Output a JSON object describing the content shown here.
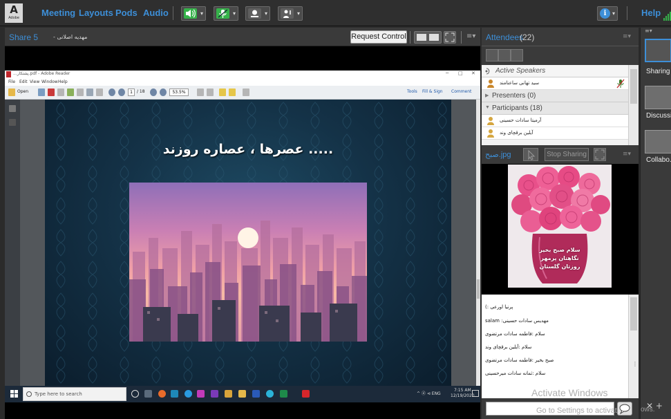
{
  "menubar": {
    "logo_text": "A",
    "logo_sub": "Adobe",
    "items": [
      "Meeting",
      "Layouts",
      "Pods",
      "Audio"
    ],
    "help": "Help"
  },
  "share_pod": {
    "title": "Share 5",
    "subtitle": "- مهدیه اصلانی",
    "request_control": "Request Control",
    "menu_icon": "≡▾"
  },
  "reader": {
    "window_title": "...پشتکار.pdf - Adobe Reader",
    "menu": [
      "File",
      "Edit",
      "View",
      "Window",
      "Help"
    ],
    "open_label": "Open",
    "page_current": "1",
    "page_total": "/ 18",
    "zoom": "53.5%",
    "right_tools": [
      "Tools",
      "Fill & Sign",
      "Comment"
    ],
    "slide_title": "..... عصرها ، عصاره روزند"
  },
  "taskbar": {
    "search_placeholder": "Type here to search",
    "tray": "^ ⓓ ⊲ ENG",
    "time": "7:15 AM",
    "date": "12/19/2020"
  },
  "attendees": {
    "title": "Attendees",
    "count": "(22)",
    "active_speakers": "Active Speakers",
    "speaker_name": "سید تهانی ساعنامند",
    "presenters": "Presenters (0)",
    "participants": "Participants (18)",
    "participant_1": "آرمیتا سادات حسینی",
    "participant_2": "آیلین برقچای وند"
  },
  "image_pod": {
    "title": "صبح.jpg",
    "stop_sharing": "Stop Sharing",
    "caption_lines": [
      "سلام صبح بخیر",
      "نگاهتان پرمهر",
      "روزتان گلستان"
    ]
  },
  "chat": {
    "messages": [
      "(: پرنیا اورعی",
      "salam :مهدیس سادات حسینی",
      "سلام :فاطمه سادات مرتضوی",
      "سلام :آیلین برقچای وند",
      "صبح بخیر :فاطمه سادات مرتضوی",
      "سلام :ثمانه سادات میرحسینی"
    ],
    "activate_line1": "Activate Windows",
    "activate_line2": "Go to Settings to activate",
    "activate_tail": "ows."
  },
  "layouts": {
    "items": [
      "Sharing",
      "Discussion",
      "Collabo..."
    ],
    "bottom": "✕ +"
  },
  "colors": {
    "accent": "#3d8fd8",
    "pod_header": "#3a3a3a",
    "title_text": "#3d8fd8"
  }
}
